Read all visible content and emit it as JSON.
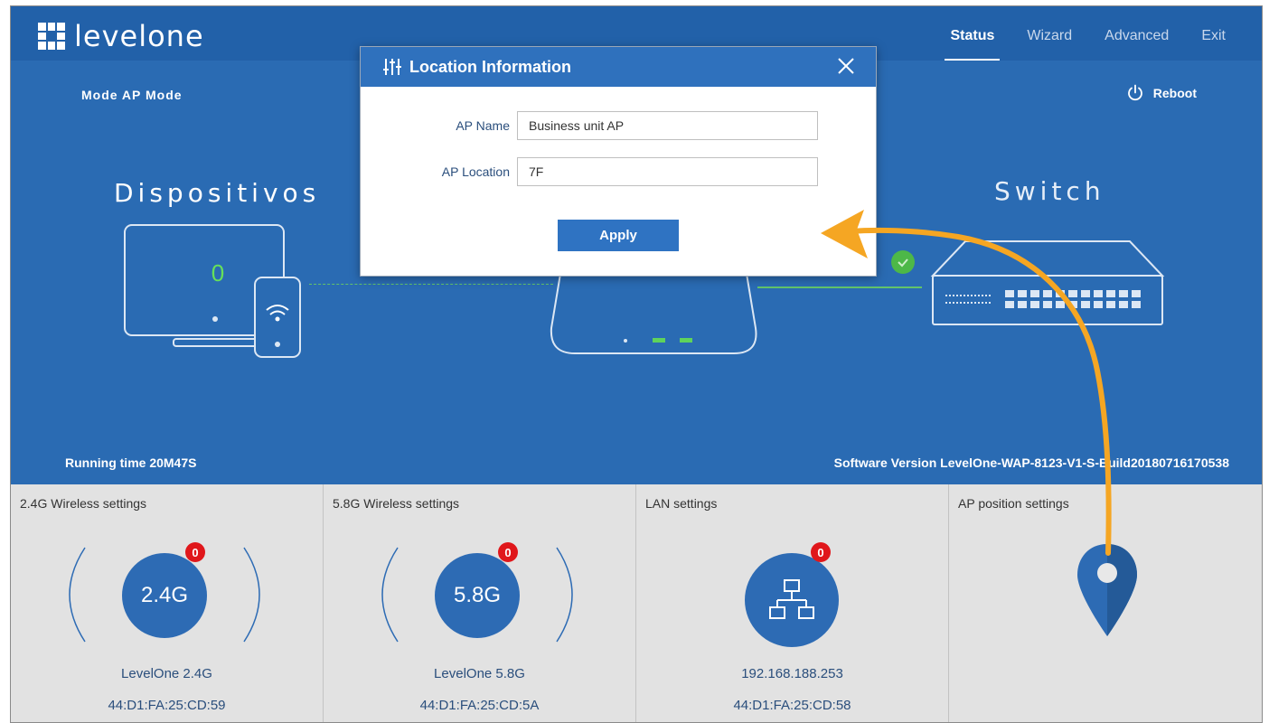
{
  "brand": {
    "logo_text": "levelone"
  },
  "nav": {
    "items": [
      "Status",
      "Wizard",
      "Advanced",
      "Exit"
    ],
    "active": "Status"
  },
  "hero": {
    "mode_text": "Mode  AP Mode",
    "reboot_label": "Reboot",
    "devices_title": "Dispositivos",
    "devices_count": "0",
    "switch_title": "Switch",
    "running_time": "Running time  20M47S",
    "software_version": "Software Version  LevelOne-WAP-8123-V1-S-Build20180716170538"
  },
  "panels": [
    {
      "title": "2.4G Wireless settings",
      "circle_label": "2.4G",
      "badge": "0",
      "line1": "LevelOne 2.4G",
      "line2": "44:D1:FA:25:CD:59"
    },
    {
      "title": "5.8G Wireless settings",
      "circle_label": "5.8G",
      "badge": "0",
      "line1": "LevelOne 5.8G",
      "line2": "44:D1:FA:25:CD:5A"
    },
    {
      "title": "LAN settings",
      "badge": "0",
      "line1": "192.168.188.253",
      "line2": "44:D1:FA:25:CD:58"
    },
    {
      "title": "AP position settings"
    }
  ],
  "modal": {
    "title": "Location Information",
    "ap_name_label": "AP Name",
    "ap_name_value": "Business unit AP",
    "ap_location_label": "AP Location",
    "ap_location_value": "7F",
    "apply_label": "Apply"
  },
  "colors": {
    "header": "#2261a9",
    "hero": "#2a6bb3",
    "badge": "#e0171b",
    "accent_green": "#62c36a",
    "annotation_arrow": "#f5a623"
  }
}
